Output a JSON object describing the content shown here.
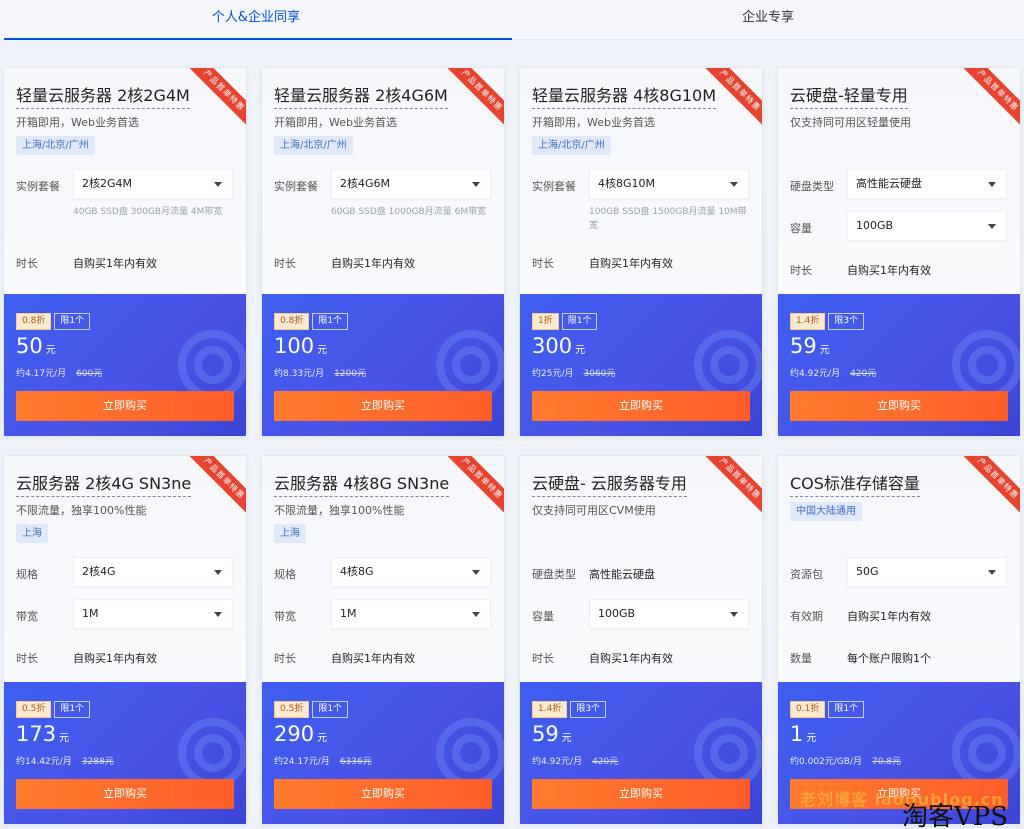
{
  "tabs": [
    "个人&企业同享",
    "企业专享"
  ],
  "ribbon_text": "产品首单特惠",
  "cards": [
    {
      "title": "轻量云服务器 2核2G4M",
      "subtitle": "开箱即用，Web业务首选",
      "region": "上海/北京/广州",
      "fields": [
        {
          "label": "实例套餐",
          "select": "2核2G4M",
          "desc": "40GB SSD盘 300GB月流量 4M带宽"
        },
        {
          "label": "时长",
          "value": "自购买1年内有效"
        }
      ],
      "discount": "0.8折",
      "limit": "限1个",
      "price": "50",
      "unit": "元",
      "monthly": "约4.17元/月",
      "original": "600元",
      "buy": "立即购买"
    },
    {
      "title": "轻量云服务器 2核4G6M",
      "subtitle": "开箱即用，Web业务首选",
      "region": "上海/北京/广州",
      "fields": [
        {
          "label": "实例套餐",
          "select": "2核4G6M",
          "desc": "60GB SSD盘 1000GB月流量 6M带宽"
        },
        {
          "label": "时长",
          "value": "自购买1年内有效"
        }
      ],
      "discount": "0.8折",
      "limit": "限1个",
      "price": "100",
      "unit": "元",
      "monthly": "约8.33元/月",
      "original": "1200元",
      "buy": "立即购买"
    },
    {
      "title": "轻量云服务器 4核8G10M",
      "subtitle": "开箱即用，Web业务首选",
      "region": "上海/北京/广州",
      "fields": [
        {
          "label": "实例套餐",
          "select": "4核8G10M",
          "desc": "100GB SSD盘 1500GB月流量 10M带宽"
        },
        {
          "label": "时长",
          "value": "自购买1年内有效"
        }
      ],
      "discount": "1折",
      "limit": "限1个",
      "price": "300",
      "unit": "元",
      "monthly": "约25元/月",
      "original": "3060元",
      "buy": "立即购买"
    },
    {
      "title": "云硬盘-轻量专用",
      "subtitle": "仅支持同可用区轻量使用",
      "fields": [
        {
          "label": "硬盘类型",
          "select": "高性能云硬盘"
        },
        {
          "label": "容量",
          "select": "100GB"
        },
        {
          "label": "时长",
          "value": "自购买1年内有效"
        }
      ],
      "discount": "1.4折",
      "limit": "限3个",
      "price": "59",
      "unit": "元",
      "monthly": "约4.92元/月",
      "original": "420元",
      "buy": "立即购买"
    },
    {
      "title": "云服务器 2核4G SN3ne",
      "subtitle": "不限流量，独享100%性能",
      "region": "上海",
      "fields": [
        {
          "label": "规格",
          "select": "2核4G"
        },
        {
          "label": "带宽",
          "select": "1M"
        },
        {
          "label": "时长",
          "value": "自购买1年内有效"
        }
      ],
      "discount": "0.5折",
      "limit": "限1个",
      "price": "173",
      "unit": "元",
      "monthly": "约14.42元/月",
      "original": "3288元",
      "buy": "立即购买"
    },
    {
      "title": "云服务器 4核8G SN3ne",
      "subtitle": "不限流量，独享100%性能",
      "region": "上海",
      "fields": [
        {
          "label": "规格",
          "select": "4核8G"
        },
        {
          "label": "带宽",
          "select": "1M"
        },
        {
          "label": "时长",
          "value": "自购买1年内有效"
        }
      ],
      "discount": "0.5折",
      "limit": "限1个",
      "price": "290",
      "unit": "元",
      "monthly": "约24.17元/月",
      "original": "6336元",
      "buy": "立即购买"
    },
    {
      "title": "云硬盘- 云服务器专用",
      "subtitle": "仅支持同可用区CVM使用",
      "fields": [
        {
          "label": "硬盘类型",
          "value": "高性能云硬盘"
        },
        {
          "label": "容量",
          "select": "100GB"
        },
        {
          "label": "时长",
          "value": "自购买1年内有效"
        }
      ],
      "discount": "1.4折",
      "limit": "限3个",
      "price": "59",
      "unit": "元",
      "monthly": "约4.92元/月",
      "original": "420元",
      "buy": "立即购买"
    },
    {
      "title": "COS标准存储容量",
      "region": "中国大陆通用",
      "fields": [
        {
          "label": "资源包",
          "select": "50G"
        },
        {
          "label": "有效期",
          "value": "自购买1年内有效"
        },
        {
          "label": "数量",
          "value": "每个账户限购1个"
        }
      ],
      "discount": "0.1折",
      "limit": "限1个",
      "price": "1",
      "unit": "元",
      "monthly": "约0.002元/GB/月",
      "original": "70.8元",
      "buy": "立即购买"
    }
  ],
  "watermark": {
    "line1": "老刘博客 laoliublog.cn",
    "line2": "淘客VPS"
  }
}
